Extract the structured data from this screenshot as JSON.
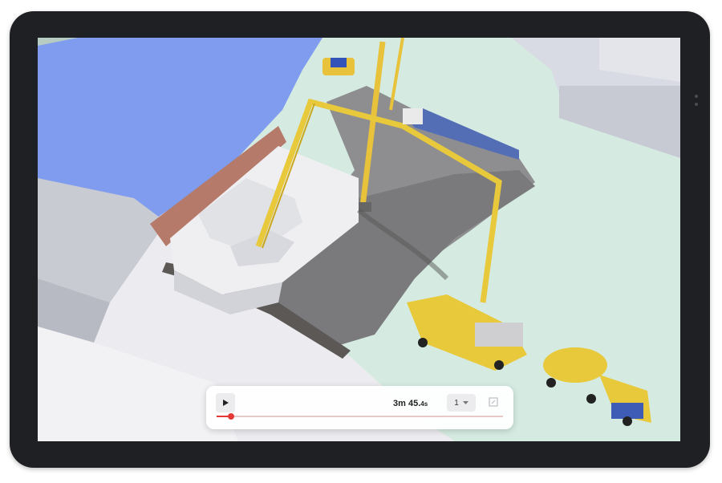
{
  "player": {
    "play_icon": "play-icon",
    "time_main": "3m 45.",
    "time_fraction": "4s",
    "speed_value": "1",
    "speed_icon": "chevron-down-icon",
    "fullscreen_icon": "expand-icon",
    "progress": 0.05,
    "accent_color": "#e53935"
  }
}
